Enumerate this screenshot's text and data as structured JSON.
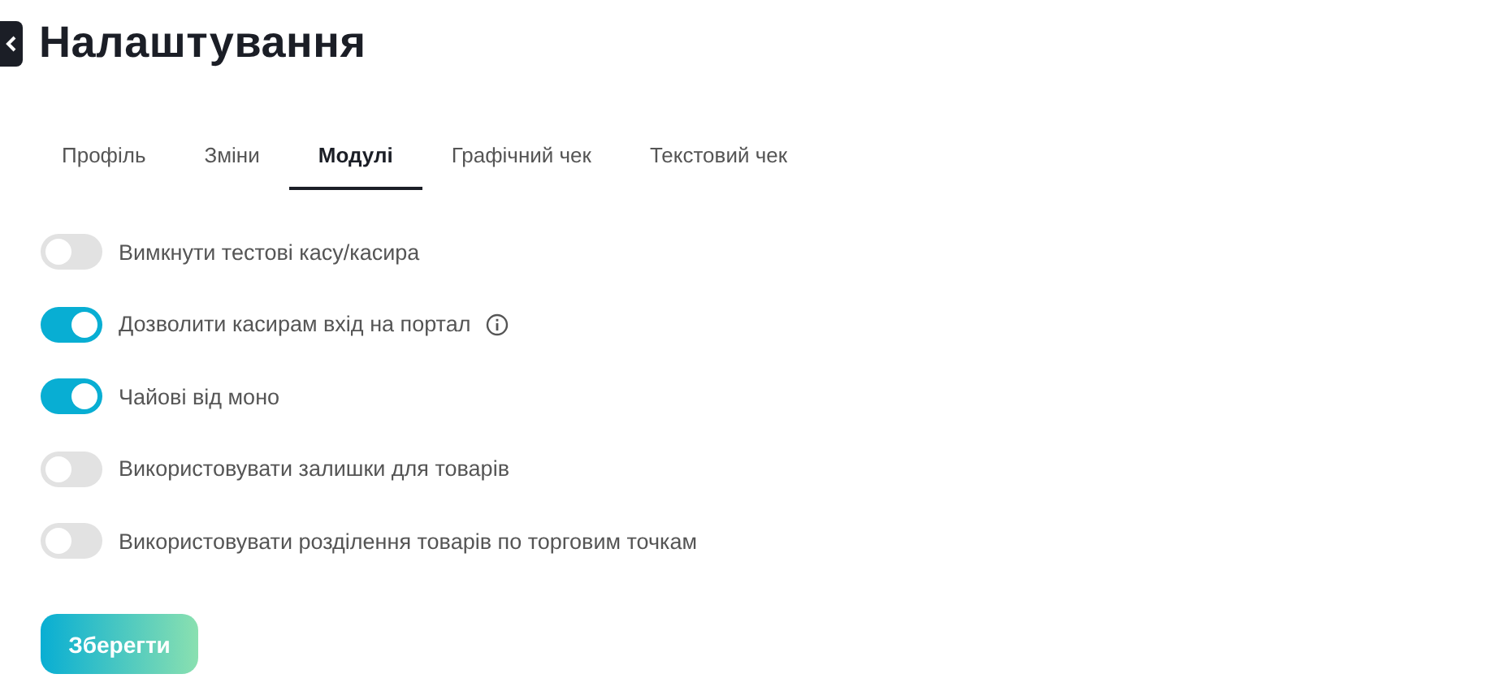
{
  "header": {
    "title": "Налаштування"
  },
  "tabs": [
    {
      "label": "Профіль",
      "selected": false
    },
    {
      "label": "Зміни",
      "selected": false
    },
    {
      "label": "Модулі",
      "selected": true
    },
    {
      "label": "Графічний чек",
      "selected": false
    },
    {
      "label": "Текстовий чек",
      "selected": false
    }
  ],
  "settings": [
    {
      "label": "Вимкнути тестові касу/касира",
      "on": false,
      "info": false
    },
    {
      "label": "Дозволити касирам вхід на портал",
      "on": true,
      "info": true
    },
    {
      "label": "Чайові від моно",
      "on": true,
      "info": false
    },
    {
      "label": "Використовувати залишки для товарів",
      "on": false,
      "info": false
    },
    {
      "label": "Використовувати розділення товарів по торговим точкам",
      "on": false,
      "info": false
    }
  ],
  "save_button": "Зберегти"
}
